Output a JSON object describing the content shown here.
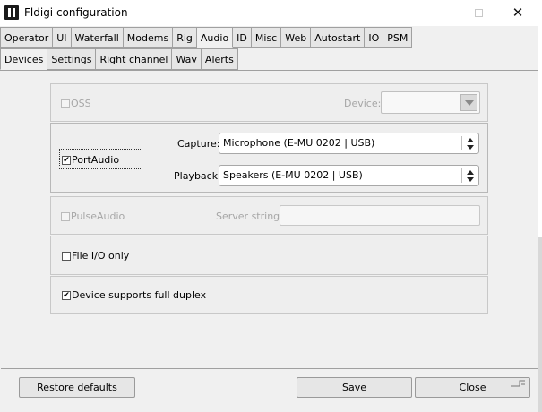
{
  "window": {
    "title": "Fldigi configuration",
    "controls": {
      "minimize": "minimize-icon",
      "maximize": "maximize-icon",
      "close": "✕"
    }
  },
  "tabs": [
    "Operator",
    "UI",
    "Waterfall",
    "Modems",
    "Rig",
    "Audio",
    "ID",
    "Misc",
    "Web",
    "Autostart",
    "IO",
    "PSM"
  ],
  "active_tab": "Audio",
  "subtabs": [
    "Devices",
    "Settings",
    "Right channel",
    "Wav",
    "Alerts"
  ],
  "active_subtab": "Devices",
  "devices": {
    "oss": {
      "label": "OSS",
      "checked": false,
      "enabled": false,
      "device_label": "Device:",
      "device_value": ""
    },
    "portaudio": {
      "label": "PortAudio",
      "checked": true,
      "capture_label": "Capture:",
      "capture_value": "Microphone (E-MU 0202 | USB)",
      "playback_label": "Playback:",
      "playback_value": "Speakers (E-MU 0202 | USB)"
    },
    "pulseaudio": {
      "label": "PulseAudio",
      "checked": false,
      "enabled": false,
      "server_label": "Server string:",
      "server_value": ""
    },
    "file_io": {
      "label": "File I/O only",
      "checked": false
    },
    "full_duplex": {
      "label": "Device supports full duplex",
      "checked": true
    }
  },
  "buttons": {
    "restore": "Restore defaults",
    "save": "Save",
    "close": "Close"
  },
  "check_mark": "✔",
  "colors": {
    "window_bg": "#f0f0f0",
    "disabled_text": "#a6a6a6"
  }
}
